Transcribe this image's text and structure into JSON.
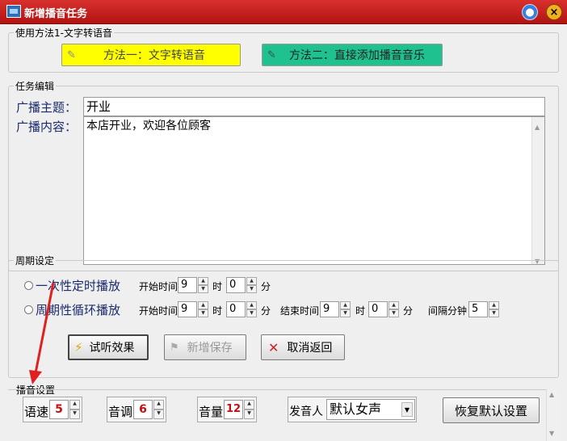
{
  "window": {
    "title": "新增播音任务"
  },
  "method_group": {
    "legend": "使用方法1-文字转语音",
    "method1_label": "方法一：文字转语音",
    "method2_label": "方法二：直接添加播音音乐"
  },
  "task_group": {
    "legend": "任务编辑",
    "topic_label": "广播主题：",
    "topic_value": "开业",
    "content_label": "广播内容：",
    "content_value": "本店开业，欢迎各位顾客"
  },
  "period_group": {
    "legend": "周期设定",
    "once_label": "一次性定时播放",
    "loop_label": "周期性循环播放",
    "start_time_label": "开始时间",
    "hour_label": "时",
    "minute_label": "分",
    "end_time_label": "结束时间",
    "interval_label": "间隔分钟",
    "once_start_hour": "9",
    "once_start_min": "0",
    "loop_start_hour": "9",
    "loop_start_min": "0",
    "loop_end_hour": "9",
    "loop_end_min": "0",
    "interval_value": "5",
    "preview_button": "试听效果",
    "save_button": "新增保存",
    "cancel_button": "取消返回"
  },
  "broadcast_group": {
    "legend": "播音设置",
    "speed_label": "语速",
    "speed_value": "5",
    "tone_label": "音调",
    "tone_value": "6",
    "volume_label": "音量",
    "volume_value": "12",
    "speaker_label": "发音人",
    "speaker_value": "默认女声",
    "reset_button": "恢复默认设置"
  },
  "colors": {
    "titlebar": "#c0201d",
    "method1_bg": "#ffff00",
    "method2_bg": "#1fc28f",
    "arrow": "#e02020"
  }
}
